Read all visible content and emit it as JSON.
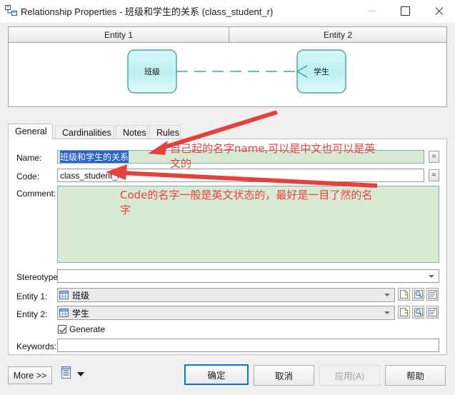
{
  "window": {
    "title": "Relationship Properties - 班级和学生的关系 (class_student_r)",
    "icon": "relationship-icon",
    "controls": {
      "minimize": "–",
      "maximize": "□",
      "close": "✕"
    }
  },
  "preview": {
    "headers": [
      "Entity 1",
      "Entity 2"
    ],
    "entity_left": "班级",
    "entity_right": "学生",
    "link_style": "dashed-crowsfoot"
  },
  "tabs": [
    {
      "label": "General",
      "active": true
    },
    {
      "label": "Cardinalities",
      "active": false
    },
    {
      "label": "Notes",
      "active": false
    },
    {
      "label": "Rules",
      "active": false
    }
  ],
  "general": {
    "name_label": "Name:",
    "name_value": "班级和学生的关系",
    "name_selected": true,
    "code_label": "Code:",
    "code_value": "class_student_r",
    "comment_label": "Comment:",
    "comment_value": "",
    "stereotype_label": "Stereotype:",
    "stereotype_value": "",
    "entity1_label": "Entity 1:",
    "entity1_value": "班级",
    "entity2_label": "Entity 2:",
    "entity2_value": "学生",
    "generate_label": "Generate",
    "generate_checked": true,
    "keywords_label": "Keywords:",
    "keywords_value": "",
    "equals_button_label": "=",
    "row_buttons": [
      "new-icon",
      "browse-icon",
      "properties-icon"
    ]
  },
  "footer": {
    "more_label": "More >>",
    "report_icon": "report-icon",
    "ok_label": "确定",
    "cancel_label": "取消",
    "apply_label": "应用(A)",
    "help_label": "帮助",
    "apply_disabled": true
  },
  "annotations": [
    {
      "text": "自己起的名字name,可以是中文也可以是英\n文的",
      "color": "#e8403a"
    },
    {
      "text": "Code的名字一般是英文状态的，最好是一目了然的名\n字",
      "color": "#e8403a"
    }
  ],
  "colors": {
    "annotation_red": "#e8403a",
    "entity_fill": "#c9f2f4",
    "entity_border": "#2f8f96",
    "comment_bg": "#d9ead3",
    "selection_blue": "#2a64c8",
    "default_button_border": "#0078d7"
  }
}
